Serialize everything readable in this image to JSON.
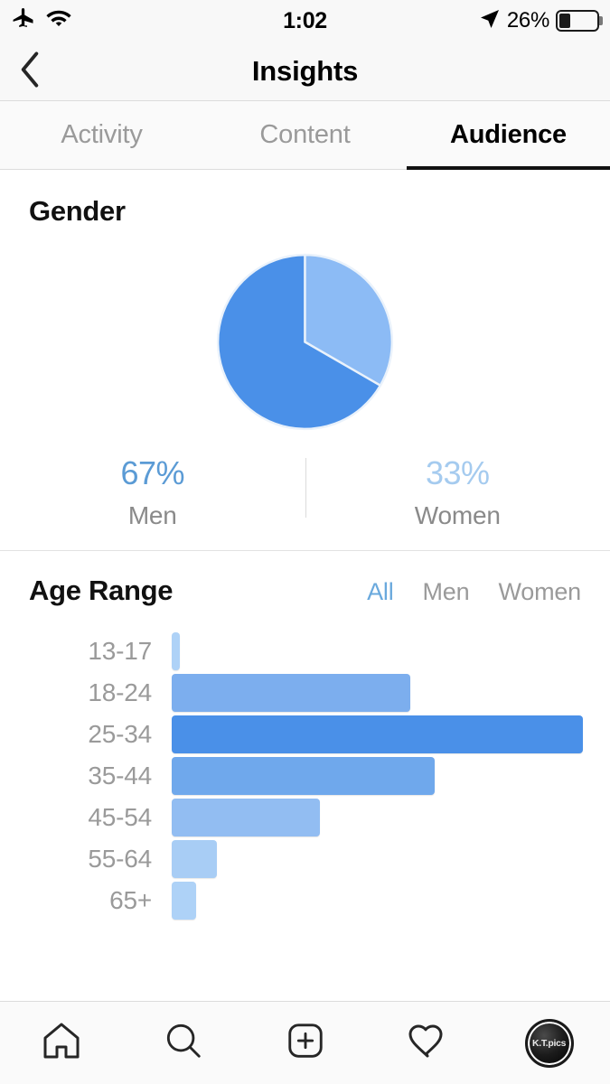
{
  "status_bar": {
    "airplane_icon": "airplane-icon",
    "wifi_icon": "wifi-icon",
    "time": "1:02",
    "location_icon": "location-arrow-icon",
    "battery_percent": "26%",
    "battery_level": 26
  },
  "nav": {
    "back_icon": "chevron-left-icon",
    "title": "Insights"
  },
  "tabs": [
    {
      "label": "Activity",
      "active": false
    },
    {
      "label": "Content",
      "active": false
    },
    {
      "label": "Audience",
      "active": true
    }
  ],
  "gender": {
    "title": "Gender",
    "legend": [
      {
        "percent": "67%",
        "label": "Men"
      },
      {
        "percent": "33%",
        "label": "Women"
      }
    ]
  },
  "age": {
    "title": "Age Range",
    "filters": [
      {
        "label": "All",
        "active": true
      },
      {
        "label": "Men",
        "active": false
      },
      {
        "label": "Women",
        "active": false
      }
    ]
  },
  "bottom_nav": [
    {
      "icon": "home-icon",
      "label": "Home"
    },
    {
      "icon": "search-icon",
      "label": "Search"
    },
    {
      "icon": "add-post-icon",
      "label": "Add"
    },
    {
      "icon": "heart-icon",
      "label": "Activity"
    },
    {
      "icon": "profile-avatar",
      "label": "K.T.pics"
    }
  ],
  "colors": {
    "pie_men": "#4a90e8",
    "pie_women": "#8cbbf5",
    "bar_max": "#4a90e8",
    "accent": "#6aa9dd",
    "text_muted": "#9a9a9a"
  },
  "chart_data": [
    {
      "type": "pie",
      "title": "Gender",
      "labels": [
        "Men",
        "Women"
      ],
      "values": [
        67,
        33
      ],
      "unit": "%",
      "colors": [
        "#4a90e8",
        "#8cbbf5"
      ],
      "start_angle": 0,
      "direction": "clockwise",
      "legend": "bottom"
    },
    {
      "type": "bar",
      "orientation": "horizontal",
      "title": "Age Range",
      "filter_selected": "All",
      "categories": [
        "13-17",
        "18-24",
        "25-34",
        "35-44",
        "45-54",
        "55-64",
        "65+"
      ],
      "values": [
        2,
        58,
        100,
        64,
        36,
        11,
        6
      ],
      "unit": "relative % of max bar",
      "bar_colors": [
        "#aed2f7",
        "#7caeee",
        "#4a90e8",
        "#6fa8ec",
        "#92bdf2",
        "#a8cdf5",
        "#aed2f7"
      ],
      "xlabel": "",
      "ylabel": "",
      "xlim": [
        0,
        100
      ],
      "grid": false,
      "legend": "none"
    }
  ]
}
